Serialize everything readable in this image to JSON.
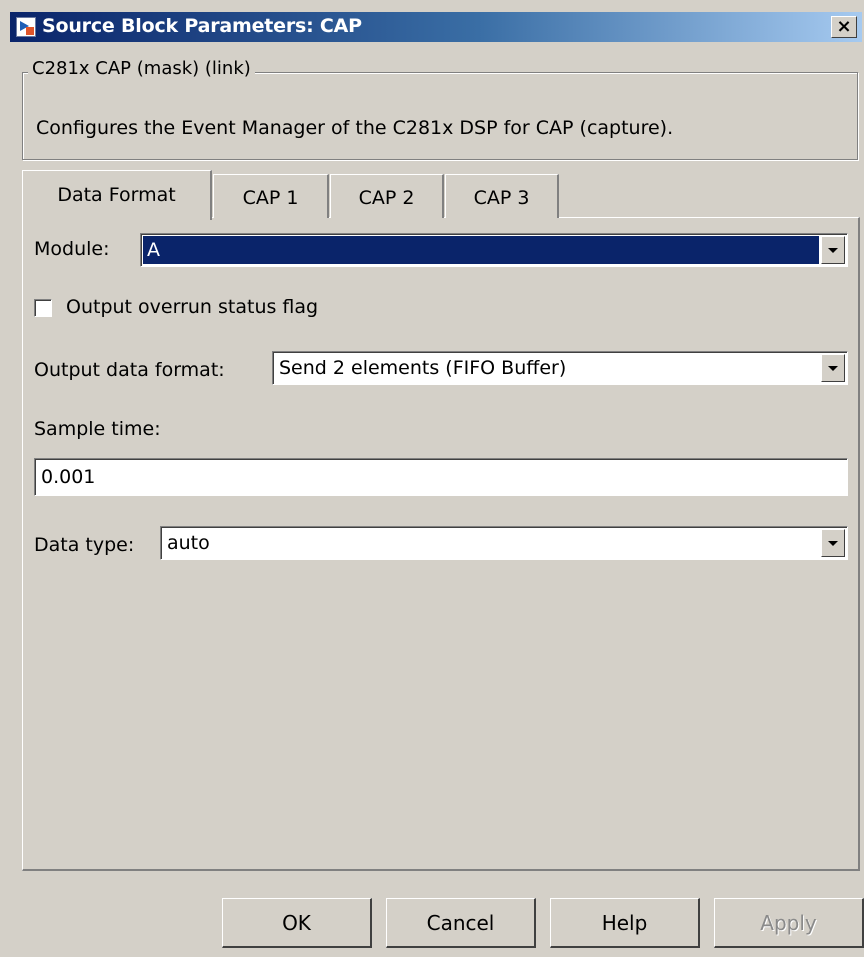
{
  "window": {
    "title": "Source Block Parameters: CAP",
    "icon": "simulink-block-icon",
    "close_label": "×"
  },
  "group": {
    "legend": "C281x CAP (mask) (link)",
    "description": "Configures the Event Manager of the C281x DSP for CAP (capture)."
  },
  "tabs": [
    {
      "label": "Data Format",
      "active": true
    },
    {
      "label": "CAP 1",
      "active": false
    },
    {
      "label": "CAP 2",
      "active": false
    },
    {
      "label": "CAP 3",
      "active": false
    }
  ],
  "form": {
    "module_label": "Module:",
    "module_value": "A",
    "overrun_label": "Output overrun status flag",
    "overrun_checked": false,
    "output_format_label": "Output data format:",
    "output_format_value": "Send 2 elements (FIFO Buffer)",
    "sample_time_label": "Sample time:",
    "sample_time_value": "0.001",
    "data_type_label": "Data type:",
    "data_type_value": "auto"
  },
  "buttons": {
    "ok": "OK",
    "cancel": "Cancel",
    "help": "Help",
    "apply": "Apply"
  },
  "colors": {
    "dialog_bg": "#d4d0c8",
    "title_bar": "#0a246a",
    "selection": "#0a246a"
  }
}
